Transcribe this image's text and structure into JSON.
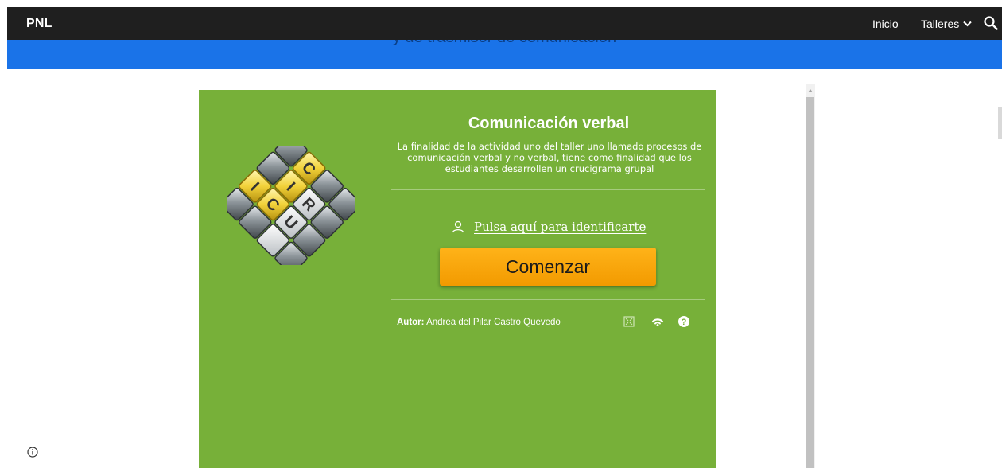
{
  "header": {
    "site_title": "PNL",
    "nav": {
      "inicio": "Inicio",
      "talleres": "Talleres"
    }
  },
  "banner": {
    "partial_text": "y de trasmisor de comunicación"
  },
  "activity": {
    "title": "Comunicación verbal",
    "description": "La finalidad de la actividad uno del taller uno llamado procesos de comunicación verbal y no verbal, tiene como finalidad que los estudiantes desarrollen un crucigrama grupal",
    "login_link": "Pulsa aquí para identificarte",
    "start_button": "Comenzar",
    "author_label": "Autor:",
    "author_name": "Andrea del Pilar Castro Quevedo",
    "logo_letters": [
      "C",
      "R",
      "U",
      "I",
      "C",
      "I"
    ]
  },
  "colors": {
    "topbar": "#1f1f1f",
    "banner": "#1a73e8",
    "card_background": "#77b039",
    "start_button": "#f7a20d"
  },
  "icons": [
    "search-icon",
    "chevron-down-icon",
    "user-icon",
    "fullscreen-icon",
    "wifi-icon",
    "help-icon",
    "info-icon"
  ]
}
